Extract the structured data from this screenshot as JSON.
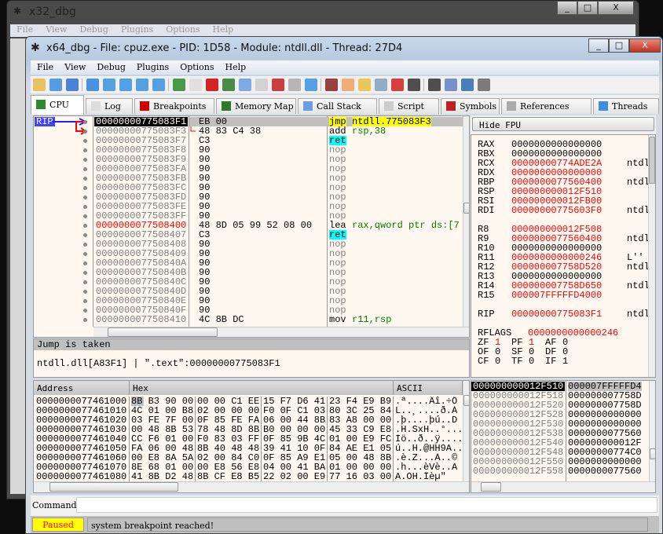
{
  "bg_window": {
    "title": "x32_dbg",
    "menu": [
      "File",
      "View",
      "Debug",
      "Plugins",
      "Options",
      "Help"
    ]
  },
  "window": {
    "title": "x64_dbg - File: cpuz.exe - PID: 1D58 - Module: ntdll.dll - Thread: 27D4",
    "minimize": "_",
    "maximize": "□",
    "close": "X"
  },
  "menu": [
    "File",
    "View",
    "Debug",
    "Plugins",
    "Options",
    "Help"
  ],
  "toolbar": [
    {
      "icon": "open-folder-icon",
      "color": "#e8b84a"
    },
    {
      "icon": "restart-icon",
      "color": "#3a8ee0"
    },
    {
      "icon": "stop-icon",
      "color": "#2a70d0"
    },
    {
      "icon": "run-icon",
      "color": "#2a80e0"
    },
    {
      "icon": "pause-icon",
      "color": "#3a90e0"
    },
    {
      "icon": "step-into-icon",
      "color": "#3a90e0"
    },
    {
      "icon": "step-over-icon",
      "color": "#3a90e0"
    },
    {
      "icon": "execute-till-return-icon",
      "color": "#3a90e0"
    },
    {
      "icon": "cpu-icon",
      "color": "#2c8a2c"
    },
    {
      "icon": "log-icon",
      "color": "#ddd"
    },
    {
      "icon": "breakpoint-icon",
      "color": "#d00000"
    },
    {
      "icon": "memory-map-icon",
      "color": "#2a7a2a"
    },
    {
      "icon": "call-stack-icon",
      "color": "#6a9ee0"
    },
    {
      "icon": "script-icon",
      "color": "#ccc"
    },
    {
      "icon": "symbols-icon",
      "color": "#c02020"
    },
    {
      "icon": "references-icon",
      "color": "#aaa"
    },
    {
      "icon": "threads-icon",
      "color": "#3a90e0"
    },
    {
      "icon": "scylla-icon",
      "color": "#8a2020"
    },
    {
      "icon": "patch-icon",
      "color": "#f0a060"
    },
    {
      "icon": "comments-icon",
      "color": "#e8c040"
    },
    {
      "icon": "labels-icon",
      "color": "#80a0c0"
    },
    {
      "icon": "bookmarks-icon",
      "color": "#d02020"
    },
    {
      "icon": "functions-icon",
      "color": "#333"
    },
    {
      "icon": "strings-icon",
      "color": "#333"
    },
    {
      "icon": "calculator-device-icon",
      "color": "#6080c0"
    },
    {
      "icon": "globe-icon",
      "color": "#2a6ab0"
    },
    {
      "icon": "calculator-icon",
      "color": "#666"
    }
  ],
  "tabs": [
    {
      "label": "CPU",
      "icon": "cpu-icon",
      "active": true
    },
    {
      "label": "Log",
      "icon": "log-icon"
    },
    {
      "label": "Breakpoints",
      "icon": "breakpoint-icon"
    },
    {
      "label": "Memory Map",
      "icon": "memory-map-icon"
    },
    {
      "label": "Call Stack",
      "icon": "call-stack-icon"
    },
    {
      "label": "Script",
      "icon": "script-icon"
    },
    {
      "label": "Symbols",
      "icon": "symbols-icon"
    },
    {
      "label": "References",
      "icon": "references-icon"
    },
    {
      "label": "Threads",
      "icon": "threads-icon"
    }
  ],
  "disasm": {
    "rip_label": "RIP",
    "rows": [
      {
        "addr": "00000000775083F1",
        "bytes": "EB 00",
        "mnem": "jmp",
        "ops": "ntdll.775083F3",
        "kind": "jmp",
        "current": true
      },
      {
        "addr": "00000000775083F3",
        "bytes": "48 83 C4 38",
        "mnem": "add",
        "ops": "rsp,38"
      },
      {
        "addr": "00000000775083F7",
        "bytes": "C3",
        "mnem": "ret",
        "ops": "",
        "kind": "ret"
      },
      {
        "addr": "00000000775083F8",
        "bytes": "90",
        "mnem": "nop",
        "kind": "nop"
      },
      {
        "addr": "00000000775083F9",
        "bytes": "90",
        "mnem": "nop",
        "kind": "nop"
      },
      {
        "addr": "00000000775083FA",
        "bytes": "90",
        "mnem": "nop",
        "kind": "nop"
      },
      {
        "addr": "00000000775083FB",
        "bytes": "90",
        "mnem": "nop",
        "kind": "nop"
      },
      {
        "addr": "00000000775083FC",
        "bytes": "90",
        "mnem": "nop",
        "kind": "nop"
      },
      {
        "addr": "00000000775083FD",
        "bytes": "90",
        "mnem": "nop",
        "kind": "nop"
      },
      {
        "addr": "00000000775083FE",
        "bytes": "90",
        "mnem": "nop",
        "kind": "nop"
      },
      {
        "addr": "00000000775083FF",
        "bytes": "90",
        "mnem": "nop",
        "kind": "nop"
      },
      {
        "addr": "0000000077508400",
        "bytes": "48 8D 05 99 52 08 00",
        "mnem": "lea",
        "ops": "rax,qword ptr ds:[7",
        "kind": "lea",
        "label": true
      },
      {
        "addr": "0000000077508407",
        "bytes": "C3",
        "mnem": "ret",
        "kind": "ret"
      },
      {
        "addr": "0000000077508408",
        "bytes": "90",
        "mnem": "nop",
        "kind": "nop"
      },
      {
        "addr": "0000000077508409",
        "bytes": "90",
        "mnem": "nop",
        "kind": "nop"
      },
      {
        "addr": "000000007750840A",
        "bytes": "90",
        "mnem": "nop",
        "kind": "nop"
      },
      {
        "addr": "000000007750840B",
        "bytes": "90",
        "mnem": "nop",
        "kind": "nop"
      },
      {
        "addr": "000000007750840C",
        "bytes": "90",
        "mnem": "nop",
        "kind": "nop"
      },
      {
        "addr": "000000007750840D",
        "bytes": "90",
        "mnem": "nop",
        "kind": "nop"
      },
      {
        "addr": "000000007750840E",
        "bytes": "90",
        "mnem": "nop",
        "kind": "nop"
      },
      {
        "addr": "000000007750840F",
        "bytes": "90",
        "mnem": "nop",
        "kind": "nop"
      },
      {
        "addr": "0000000077508410",
        "bytes": "4C 8B DC",
        "mnem": "mov",
        "ops": "r11,rsp"
      }
    ]
  },
  "info": {
    "header": "Jump is taken",
    "text": "ntdll.dll[A83F1] | \".text\":00000000775083F1"
  },
  "registers": {
    "hide_fpu_label": "Hide FPU",
    "groups": [
      [
        {
          "n": "RAX",
          "v": "0000000000000000"
        },
        {
          "n": "RBX",
          "v": "0000000000000000"
        },
        {
          "n": "RCX",
          "v": "00000000774ADE2A",
          "c": true,
          "cm": "ntdl"
        },
        {
          "n": "RDX",
          "v": "0000000000000000",
          "c": true
        },
        {
          "n": "RBP",
          "v": "0000000077560400",
          "c": true,
          "cm": "ntdl"
        },
        {
          "n": "RSP",
          "v": "000000000012F510",
          "c": true
        },
        {
          "n": "RSI",
          "v": "000000000012FB00",
          "c": true
        },
        {
          "n": "RDI",
          "v": "00000000775603F0",
          "c": true,
          "cm": "ntdl"
        }
      ],
      [
        {
          "n": "R8",
          "v": "000000000012F508",
          "c": true
        },
        {
          "n": "R9",
          "v": "0000000077560400",
          "c": true,
          "cm": "ntdl"
        },
        {
          "n": "R10",
          "v": "0000000000000000"
        },
        {
          "n": "R11",
          "v": "0000000000000246",
          "c": true,
          "cm": "L''"
        },
        {
          "n": "R12",
          "v": "000000007758D520",
          "c": true,
          "cm": "ntdl"
        },
        {
          "n": "R13",
          "v": "0000000000000000"
        },
        {
          "n": "R14",
          "v": "000000007758D650",
          "c": true,
          "cm": "ntdl"
        },
        {
          "n": "R15",
          "v": "000007FFFFFD4000",
          "c": true
        }
      ],
      [
        {
          "n": "RIP",
          "v": "00000000775083F1",
          "c": true,
          "cm": "ntdl"
        }
      ]
    ],
    "rflags_label": "RFLAGS",
    "rflags": "0000000000000246",
    "flags": [
      [
        {
          "n": "ZF",
          "v": "1",
          "c": true
        },
        {
          "n": "PF",
          "v": "1",
          "c": true
        },
        {
          "n": "AF",
          "v": "0"
        }
      ],
      [
        {
          "n": "OF",
          "v": "0"
        },
        {
          "n": "SF",
          "v": "0"
        },
        {
          "n": "DF",
          "v": "0"
        }
      ],
      [
        {
          "n": "CF",
          "v": "0"
        },
        {
          "n": "TF",
          "v": "0"
        },
        {
          "n": "IF",
          "v": "1"
        }
      ]
    ]
  },
  "dump": {
    "headers": [
      "Address",
      "Hex",
      "ASCII"
    ],
    "rows": [
      {
        "addr": "0000000077461000",
        "hex": [
          "8B B3 90 00",
          "00 00 C1 EE",
          "15 F7 D6 41",
          "23 F4 E9 B9"
        ],
        "ascii": ".ª....Âî.÷Ö"
      },
      {
        "addr": "0000000077461010",
        "hex": [
          "4C 01 00 B8",
          "02 00 00 00",
          "F0 0F C1 03",
          "80 3C 25 84"
        ],
        "ascii": "L..¸....ð.Á"
      },
      {
        "addr": "0000000077461020",
        "hex": [
          "03 FE 7F 00",
          "0F 85 FE FA",
          "06 00 44 8B",
          "83 A8 00 00"
        ],
        "ascii": ".þ....þú..D"
      },
      {
        "addr": "0000000077461030",
        "hex": [
          "00 48 8B 53",
          "78 48 8D 8B",
          "B0 00 00 00",
          "45 33 C9 E8"
        ],
        "ascii": ".H.SxH..°..."
      },
      {
        "addr": "0000000077461040",
        "hex": [
          "CC F6 01 00",
          "F0 83 03 FF",
          "0F 85 9B 4C",
          "01 00 E9 FC"
        ],
        "ascii": "Ìö..ð..ÿ...."
      },
      {
        "addr": "0000000077461050",
        "hex": [
          "FA 06 00 48",
          "8B 40 48 48",
          "39 41 10 0F",
          "84 AE E1 05"
        ],
        "ascii": "ú..H.@HH9A.."
      },
      {
        "addr": "0000000077461060",
        "hex": [
          "00 E8 8A 5A",
          "02 00 84 C0",
          "0F 85 A9 E1",
          "05 00 48 8B"
        ],
        "ascii": ".è.Z...À..©"
      },
      {
        "addr": "0000000077461070",
        "hex": [
          "8E 68 01 00",
          "00 E8 56 E8",
          "04 00 41 BA",
          "01 00 00 00"
        ],
        "ascii": ".h...èVè..A"
      },
      {
        "addr": "0000000077461080",
        "hex": [
          "41 8B D2 48",
          "8B CF E8 B5",
          "22 02 00 E9",
          "77 16 03 00"
        ],
        "ascii": "A.ÒH.Ïèµ\""
      }
    ]
  },
  "stack": {
    "rows": [
      {
        "addr": "000000000012F510",
        "v": "000007FFFFFD4",
        "current": true
      },
      {
        "addr": "000000000012F518",
        "v": "000000007758D"
      },
      {
        "addr": "000000000012F520",
        "v": "000000007758D"
      },
      {
        "addr": "000000000012F528",
        "v": "0000000000000"
      },
      {
        "addr": "000000000012F530",
        "v": "0000000000000"
      },
      {
        "addr": "000000000012F538",
        "v": "0000000077560"
      },
      {
        "addr": "000000000012F540",
        "v": "000000000012F"
      },
      {
        "addr": "000000000012F548",
        "v": "00000000774C0"
      },
      {
        "addr": "000000000012F550",
        "v": "0000000000000"
      },
      {
        "addr": "000000000012F558",
        "v": "0000000077560"
      }
    ]
  },
  "command": {
    "label": "Command:",
    "value": ""
  },
  "status": {
    "state": "Paused",
    "message": "system breakpoint reached!",
    "state_bg": "#ffff00",
    "state_fg": "#ff0000"
  }
}
